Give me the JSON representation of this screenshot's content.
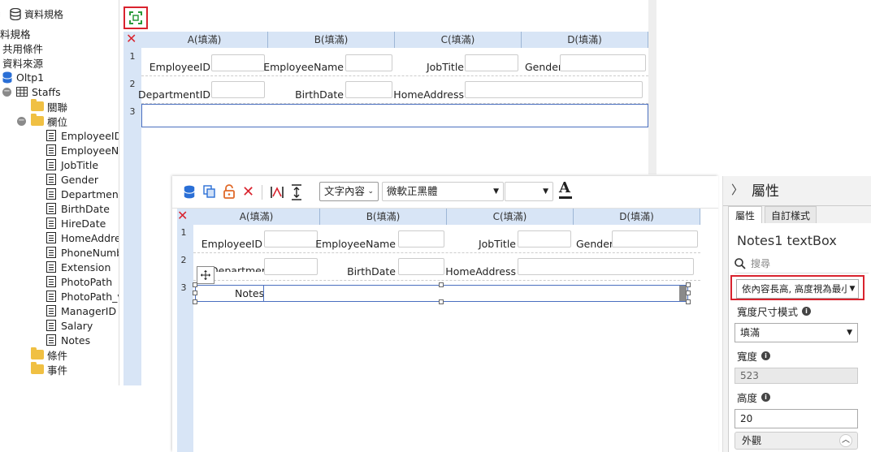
{
  "tree": {
    "header_icon_label": "資料規格",
    "items": {
      "spec": "料規格",
      "common": "共用條件",
      "source": "資料來源",
      "db": "Oltp1",
      "table": "Staffs",
      "relation": "關聯",
      "fields": "欄位",
      "conditions": "條件",
      "events": "事件"
    },
    "field_list": [
      "EmployeeID",
      "EmployeeName",
      "JobTitle",
      "Gender",
      "DepartmentID",
      "BirthDate",
      "HireDate",
      "HomeAddress",
      "PhoneNumber",
      "Extension",
      "PhotoPath",
      "PhotoPath_v",
      "ManagerID",
      "Salary",
      "Notes"
    ]
  },
  "back_designer": {
    "columns": [
      "A(填滿)",
      "B(填滿)",
      "C(填滿)",
      "D(填滿)"
    ],
    "rows": [
      "1",
      "2",
      "3"
    ],
    "row1": [
      "EmployeeID",
      "EmployeeName",
      "JobTitle",
      "Gender"
    ],
    "row2": [
      "DepartmentID",
      "BirthDate",
      "HomeAddress"
    ]
  },
  "front_designer": {
    "toolbar": {
      "content_select": "文字內容",
      "font_select": "微軟正黑體",
      "size_select": ""
    },
    "columns": [
      "A(填滿)",
      "B(填滿)",
      "C(填滿)",
      "D(填滿)"
    ],
    "rows": [
      "1",
      "2",
      "3"
    ],
    "row1": [
      "EmployeeID",
      "EmployeeName",
      "JobTitle",
      "Gender"
    ],
    "row2": [
      "DepartmentID",
      "BirthDate",
      "HomeAddress"
    ],
    "row3_label": "Notes"
  },
  "properties": {
    "title": "屬性",
    "tabs": [
      "屬性",
      "自訂樣式"
    ],
    "component": "Notes1 textBox",
    "search_placeholder": "搜尋",
    "height_mode": "依內容長高, 高度視為最小",
    "width_mode_label": "寬度尺寸模式",
    "width_mode_value": "填滿",
    "width_label": "寬度",
    "width_value": "523",
    "height_label": "高度",
    "height_value": "20",
    "appearance": "外觀"
  }
}
